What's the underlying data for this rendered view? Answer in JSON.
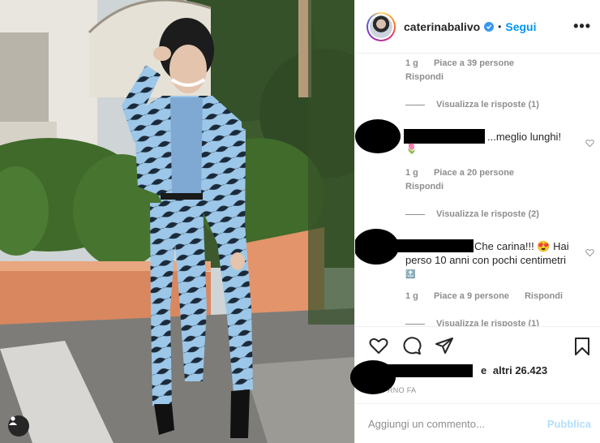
{
  "post": {
    "username": "caterinabalivo",
    "dot": "•",
    "follow_label": "Segui",
    "more_label": "•••"
  },
  "comments": [
    {
      "meta_time": "1 g",
      "meta_likes": "Piace a 39 persone",
      "reply_label": "Rispondi",
      "view_replies_label": "Visualizza le risposte (1)"
    },
    {
      "text": "...meglio lunghi!",
      "emoji": "🌷",
      "meta_time": "1 g",
      "meta_likes": "Piace a 20 persone",
      "reply_label": "Rispondi",
      "view_replies_label": "Visualizza le risposte (2)"
    },
    {
      "text_line1": "Che carina!!! 😍  Hai",
      "text_line2": "perso 10 anni con pochi centimetri",
      "emoji": "🔝",
      "meta_time": "1 g",
      "meta_likes": "Piace a 9 persone",
      "reply_label": "Rispondi",
      "view_replies_label": "Visualizza le risposte (1)"
    }
  ],
  "likes": {
    "prefix": "e",
    "others": "altri 26.423"
  },
  "time_ago": "1 GIORNO FA",
  "time_ago_visible": "RNO FA",
  "add_comment": {
    "placeholder": "Aggiungi un commento...",
    "publish_label": "Pubblica"
  },
  "icons": [
    "user-tag-icon",
    "verified-icon",
    "more-icon",
    "like-heart-icon",
    "comment-icon",
    "share-icon",
    "save-bookmark-icon"
  ],
  "colors": {
    "link_blue": "#0095f6",
    "publish_disabled": "#b2dffc",
    "meta_grey": "#8e8e8e",
    "text": "#262626"
  }
}
